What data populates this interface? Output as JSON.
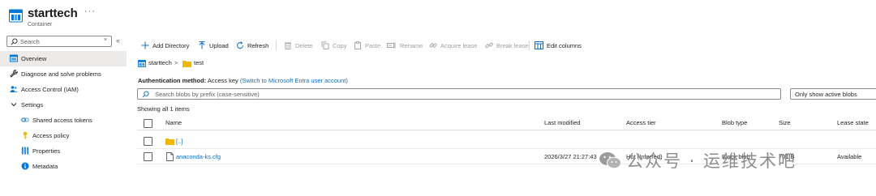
{
  "header": {
    "title": "starttech",
    "subtitle": "Container",
    "more": "···"
  },
  "sidebar": {
    "search_placeholder": "Search",
    "search_clear": "×",
    "collapse": "«",
    "items": [
      {
        "label": "Overview",
        "icon": "overview-icon",
        "active": true
      },
      {
        "label": "Diagnose and solve problems",
        "icon": "wrench-icon"
      },
      {
        "label": "Access Control (IAM)",
        "icon": "people-icon"
      },
      {
        "label": "Settings",
        "icon": "chevron-down-icon"
      },
      {
        "label": "Shared access tokens",
        "icon": "link-icon"
      },
      {
        "label": "Access policy",
        "icon": "key-icon"
      },
      {
        "label": "Properties",
        "icon": "properties-icon"
      },
      {
        "label": "Metadata",
        "icon": "info-icon"
      }
    ]
  },
  "toolbar": {
    "add_directory": "Add Directory",
    "upload": "Upload",
    "refresh": "Refresh",
    "delete": "Delete",
    "copy": "Copy",
    "paste": "Paste",
    "rename": "Rename",
    "acquire_lease": "Acquire lease",
    "break_lease": "Break lease",
    "edit_columns": "Edit columns"
  },
  "breadcrumb": {
    "root": "starttech",
    "separator": ">",
    "folder": "test"
  },
  "auth": {
    "label": "Authentication method:",
    "value": "Access key",
    "link": "(Switch to Microsoft Entra user account)"
  },
  "filter": {
    "prefix_placeholder": "Search blobs by prefix (case-sensitive)",
    "active_only": "Only show active blobs"
  },
  "showing": "Showing all 1 items",
  "table": {
    "headers": {
      "name": "Name",
      "last_modified": "Last modified",
      "access_tier": "Access tier",
      "blob_type": "Blob type",
      "size": "Size",
      "lease_state": "Lease state"
    },
    "rows": [
      {
        "name": "[..]",
        "type": "folder",
        "last_modified": "",
        "access_tier": "",
        "blob_type": "",
        "size": "",
        "lease_state": ""
      },
      {
        "name": "anaconda-ks.cfg",
        "type": "file",
        "last_modified": "2026/3/27 21:27:43",
        "access_tier": "Hot (Inferred)",
        "blob_type": "Block blob",
        "size": "701 B",
        "lease_state": "Available"
      }
    ]
  },
  "watermark": "公众号 · 运维技术吧",
  "colors": {
    "accent": "#0f6cbd",
    "folder": "#f2b705",
    "active_bg": "#edebe9"
  }
}
